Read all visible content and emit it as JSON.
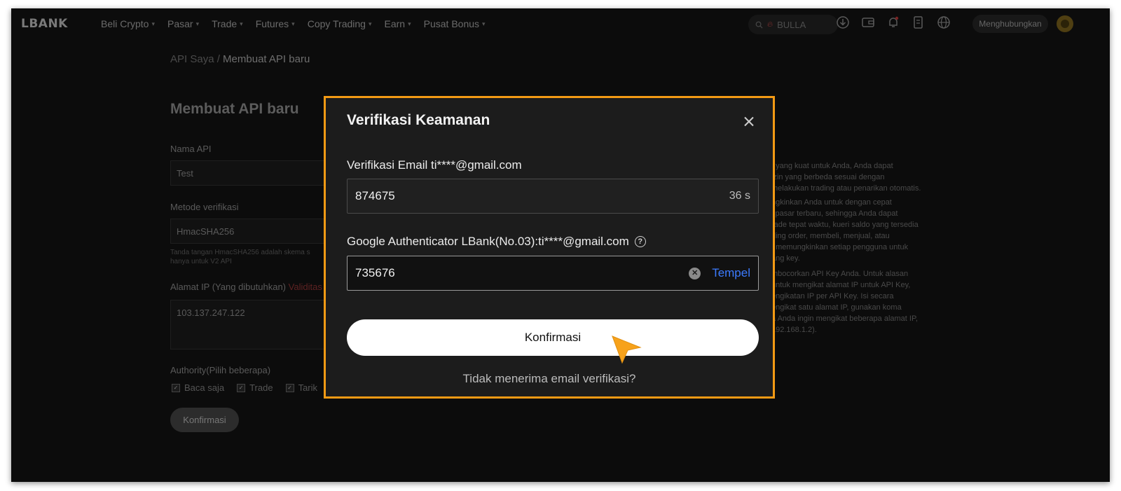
{
  "nav": {
    "logo": "LBANK",
    "menu": [
      "Beli Crypto",
      "Pasar",
      "Trade",
      "Futures",
      "Copy Trading",
      "Earn",
      "Pusat Bonus"
    ],
    "search_text": "BULLA",
    "connect_label": "Menghubungkan",
    "icons": [
      "download-icon",
      "wallet-icon",
      "bell-icon",
      "orders-icon",
      "globe-icon"
    ]
  },
  "page": {
    "breadcrumb_parent": "API Saya /",
    "breadcrumb_current": "Membuat API baru",
    "title": "Membuat API baru",
    "api_name_label": "Nama API",
    "api_name_value": "Test",
    "method_label": "Metode verifikasi",
    "method_value": "HmacSHA256",
    "method_hint": "Tanda tangan HmacSHA256 adalah skema s",
    "method_hint_2": "hanya untuk V2 API",
    "ip_label": "Alamat IP (Yang dibutuhkan)",
    "ip_required": "Validitas",
    "ip_value": "103.137.247.122",
    "authority_label": "Authority(Pilih beberapa)",
    "authority_options": [
      "Baca saja",
      "Trade",
      "Tarik"
    ],
    "confirm_label": "Konfirmasi",
    "side_note": [
      "I yang kuat untuk Anda, Anda dapat",
      "izin yang berbeda sesuai dengan",
      "melakukan trading atau penarikan otomatis.",
      "ngkinkan Anda untuk dengan cepat",
      "i pasar terbaru, sehingga Anda dapat",
      "rade tepat waktu, kueri saldo yang tersedia",
      "ding order, membeli, menjual, atau",
      "I memungkinkan setiap pengguna untuk",
      "ang key.",
      "mbocorkan API Key Anda. Untuk alasan",
      "untuk mengikat alamat IP untuk API Key,",
      "engikatan IP per API Key. Isi secara",
      "engikat satu alamat IP, gunakan koma",
      "a Anda ingin mengikat beberapa alamat IP,",
      "192.168.1.2)."
    ]
  },
  "modal": {
    "title": "Verifikasi Keamanan",
    "email_label": "Verifikasi Email ti****@gmail.com",
    "email_code": "874675",
    "email_timer": "36 s",
    "ga_label": "Google Authenticator LBank(No.03):ti****@gmail.com",
    "ga_code": "735676",
    "paste_label": "Tempel",
    "confirm_label": "Konfirmasi",
    "resend_label": "Tidak menerima email verifikasi?",
    "highlight_color": "#f39a14",
    "link_color": "#3c7bff"
  }
}
